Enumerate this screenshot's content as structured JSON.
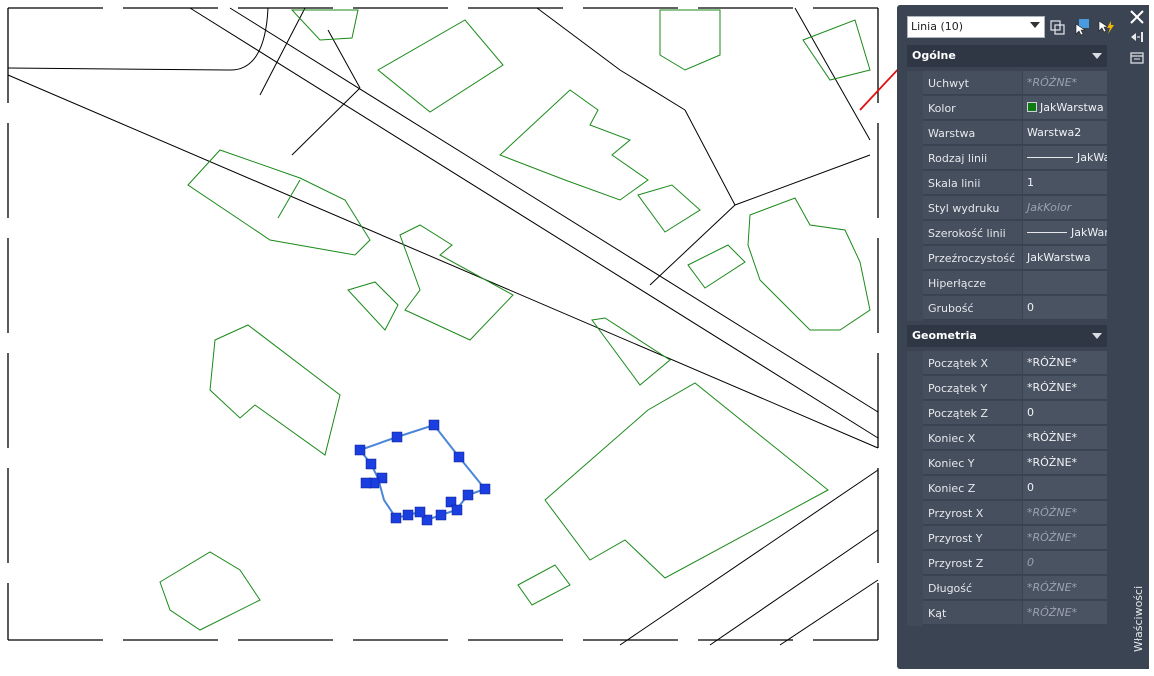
{
  "colors": {
    "panel_bg": "#3b4453",
    "drawing_bg": "#ffffff",
    "building_outline": "#1a8a1a",
    "road_line": "#000000",
    "selection_line": "#4a86d8",
    "grip": "#1a3ee0",
    "arrow": "#e01010"
  },
  "panel": {
    "object_selector": "Linia (10)",
    "palette_title": "Właściwości",
    "toolbar_icons": [
      "toggle-pickadd-icon",
      "select-objects-icon",
      "quick-select-icon"
    ],
    "sections": [
      {
        "title": "Ogólne",
        "rows": [
          {
            "name": "Uchwyt",
            "value": "*RÓŻNE*",
            "dim": true
          },
          {
            "name": "Kolor",
            "value": "JakWarstwa",
            "swatch": true
          },
          {
            "name": "Warstwa",
            "value": "Warstwa2"
          },
          {
            "name": "Rodzaj linii",
            "value": "JakWa",
            "line": true
          },
          {
            "name": "Skala linii",
            "value": "1"
          },
          {
            "name": "Styl wydruku",
            "value": "JakKolor",
            "dim": true
          },
          {
            "name": "Szerokość linii",
            "value": "JakWar",
            "line": true
          },
          {
            "name": "Przeźroczystość",
            "value": "JakWarstwa"
          },
          {
            "name": "Hiperłącze",
            "value": ""
          },
          {
            "name": "Grubość",
            "value": "0"
          }
        ]
      },
      {
        "title": "Geometria",
        "rows": [
          {
            "name": "Początek X",
            "value": "*RÓŻNE*"
          },
          {
            "name": "Początek Y",
            "value": "*RÓŻNE*"
          },
          {
            "name": "Początek Z",
            "value": "0"
          },
          {
            "name": "Koniec X",
            "value": "*RÓŻNE*"
          },
          {
            "name": "Koniec Y",
            "value": "*RÓŻNE*"
          },
          {
            "name": "Koniec Z",
            "value": "0"
          },
          {
            "name": "Przyrost X",
            "value": "*RÓŻNE*",
            "dim": true
          },
          {
            "name": "Przyrost Y",
            "value": "*RÓŻNE*",
            "dim": true
          },
          {
            "name": "Przyrost Z",
            "value": "0",
            "dim": true
          },
          {
            "name": "Długość",
            "value": "*RÓŻNE*",
            "dim": true
          },
          {
            "name": "Kąt",
            "value": "*RÓŻNE*",
            "dim": true
          }
        ]
      }
    ]
  }
}
